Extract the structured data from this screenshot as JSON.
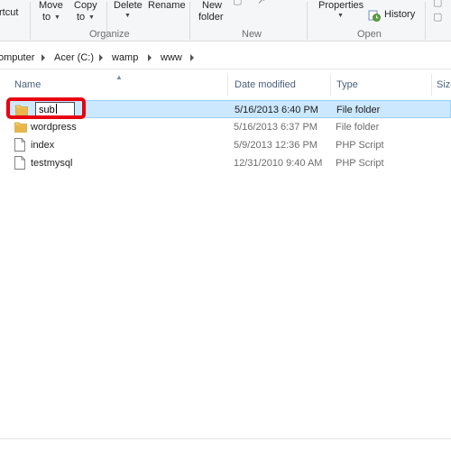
{
  "ribbon": {
    "shortcut_label": "rtcut",
    "move_to_label": "Move",
    "move_to_sub": "to",
    "copy_to_label": "Copy",
    "copy_to_sub": "to",
    "delete_label": "Delete",
    "rename_label": "Rename",
    "new_folder_label": "New",
    "new_folder_sub": "folder",
    "properties_label": "Properties",
    "history_label": "History",
    "groups": {
      "organize": "Organize",
      "new": "New",
      "open": "Open"
    }
  },
  "breadcrumb": {
    "items": [
      "omputer",
      "Acer (C:)",
      "wamp",
      "www"
    ]
  },
  "columns": {
    "name": "Name",
    "date_modified": "Date modified",
    "type": "Type",
    "size": "Size"
  },
  "files": [
    {
      "name": "sub",
      "date": "5/16/2013 6:40 PM",
      "type": "File folder",
      "icon": "folder-icon",
      "selected": true,
      "renaming": true
    },
    {
      "name": "wordpress",
      "date": "5/16/2013 6:37 PM",
      "type": "File folder",
      "icon": "folder-icon"
    },
    {
      "name": "index",
      "date": "5/9/2013 12:36 PM",
      "type": "PHP Script",
      "icon": "php-file-icon"
    },
    {
      "name": "testmysql",
      "date": "12/31/2010 9:40 AM",
      "type": "PHP Script",
      "icon": "php-file-icon"
    }
  ],
  "colors": {
    "selection": "#cce8ff",
    "highlight_annotation": "#e8000e",
    "folder": "#e8b64a"
  }
}
